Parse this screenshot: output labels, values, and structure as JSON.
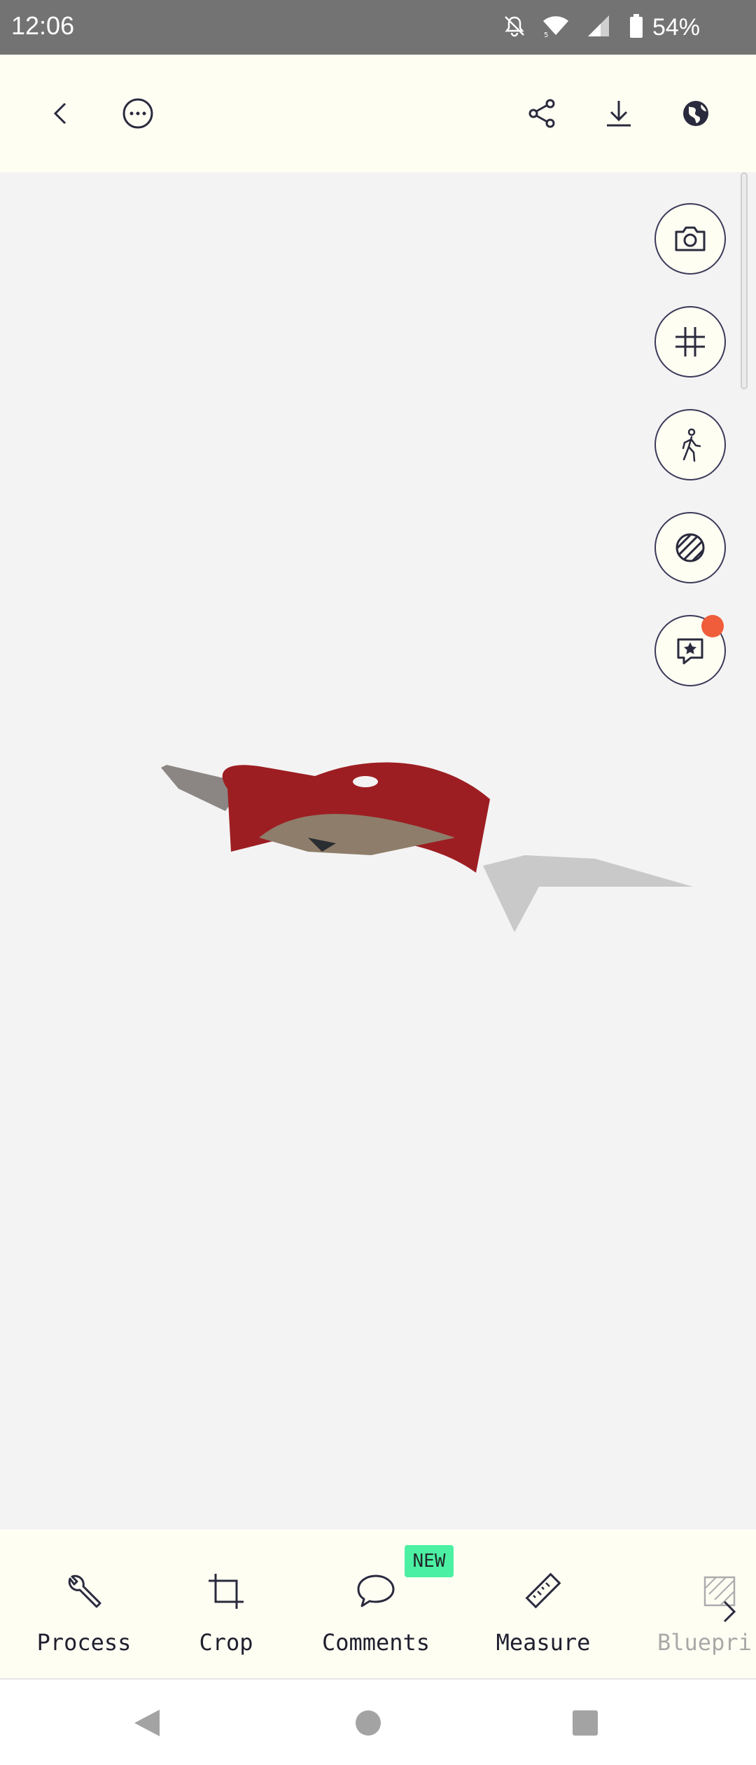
{
  "status_bar": {
    "time": "12:06",
    "battery_percent": "54%",
    "icons": [
      "mute-icon",
      "wifi-icon",
      "signal-icon",
      "battery-icon"
    ]
  },
  "top_bar": {
    "left_icons": [
      "back-icon",
      "more-options-icon"
    ],
    "right_icons": [
      "share-icon",
      "download-icon",
      "globe-icon"
    ]
  },
  "floating_actions": [
    {
      "icon": "camera-icon"
    },
    {
      "icon": "grid-icon"
    },
    {
      "icon": "walk-mode-icon"
    },
    {
      "icon": "texture-icon"
    },
    {
      "icon": "starred-comment-icon",
      "has_notification": true
    }
  ],
  "toolbar": {
    "items": [
      {
        "label": "Process",
        "icon": "wrench-icon"
      },
      {
        "label": "Crop",
        "icon": "crop-icon"
      },
      {
        "label": "Comments",
        "icon": "comment-icon",
        "badge": "NEW"
      },
      {
        "label": "Measure",
        "icon": "ruler-icon"
      },
      {
        "label": "Bluepri",
        "icon": "blueprint-icon",
        "faded": true
      }
    ],
    "badge_color": "#4cf0a2"
  },
  "nav_bar": {
    "icons": [
      "nav-back-icon",
      "nav-home-icon",
      "nav-recents-icon"
    ]
  },
  "colors": {
    "status_bar": "#737373",
    "app_bar": "#fefef3",
    "viewport": "#f4f3f3",
    "notification_dot": "#ef5d3a"
  }
}
